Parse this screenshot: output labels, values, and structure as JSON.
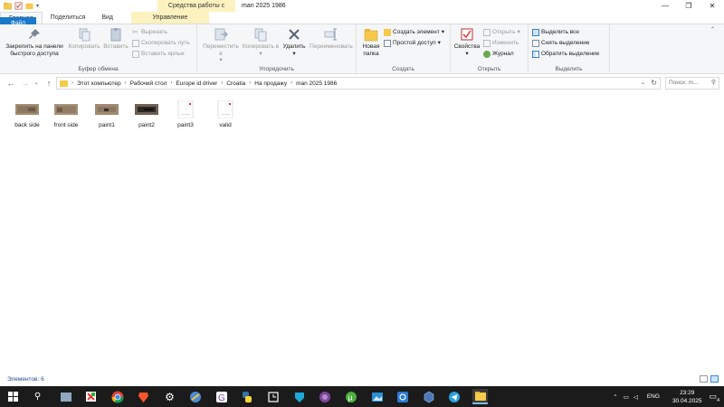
{
  "window": {
    "title": "man 2025 1986",
    "context_title": "Средства работы с рисунками",
    "controls": [
      "minimize",
      "maximize",
      "close"
    ]
  },
  "tabs": [
    {
      "label": "Файл",
      "kind": "file"
    },
    {
      "label": "Главная",
      "kind": "active"
    },
    {
      "label": "Поделиться",
      "kind": "normal"
    },
    {
      "label": "Вид",
      "kind": "normal"
    },
    {
      "label": "Управление",
      "kind": "ctx"
    }
  ],
  "ribbon": {
    "clipboard": {
      "label": "Буфер обмена",
      "pin": "Закрепить на панели быстрого доступа",
      "copy": "Копировать",
      "paste": "Вставить",
      "cut": "Вырезать",
      "copy_path": "Скопировать путь",
      "paste_shortcut": "Вставить ярлык"
    },
    "organize": {
      "label": "Упорядочить",
      "move_to": "Переместить в",
      "copy_to": "Копировать в",
      "delete": "Удалить",
      "rename": "Переименовать"
    },
    "create": {
      "label": "Создать",
      "new_folder": "Новая папка",
      "new_item": "Создать элемент",
      "easy_access": "Простой доступ"
    },
    "open": {
      "label": "Открыть",
      "properties": "Свойства",
      "open": "Открыть",
      "edit": "Изменить",
      "history": "Журнал"
    },
    "select": {
      "label": "Выделить",
      "select_all": "Выделить все",
      "select_none": "Снять выделение",
      "invert": "Обратить выделение"
    }
  },
  "address": {
    "crumbs": [
      "Этот компьютер",
      "Рабочий стол",
      "Europe id driver",
      "Croatia",
      "На продажу",
      "man 2025 1986"
    ],
    "search_placeholder": "Поиск: m..."
  },
  "files": [
    {
      "name": "back side",
      "kind": "photo-dark"
    },
    {
      "name": "front side",
      "kind": "photo-dark"
    },
    {
      "name": "paint1",
      "kind": "photo-dark"
    },
    {
      "name": "paint2",
      "kind": "photo-black"
    },
    {
      "name": "paint3",
      "kind": "doc"
    },
    {
      "name": "valid",
      "kind": "doc"
    }
  ],
  "status": {
    "count_label": "Элементов: 6"
  },
  "taskbar": {
    "icons": [
      "start-icon",
      "search-icon",
      "explorer-generic-icon",
      "app-red-icon",
      "chrome-icon",
      "brave-icon",
      "settings-icon",
      "app-circle-icon",
      "app-g-icon",
      "python-icon",
      "app-box-icon",
      "app-shield-icon",
      "tor-icon",
      "utorrent-icon",
      "app-photo-icon",
      "app-sync-icon",
      "app-cube-icon",
      "telegram-icon",
      "file-explorer-icon"
    ],
    "tray_lang": "ENG",
    "time": "23:29",
    "date": "30.04.2025",
    "notif_count": "4"
  },
  "colors": {
    "file_tab": "#1979ca",
    "context_tab": "#fcf2bf",
    "taskbar": "#1b1b1b",
    "status_text": "#1f4b8e"
  }
}
